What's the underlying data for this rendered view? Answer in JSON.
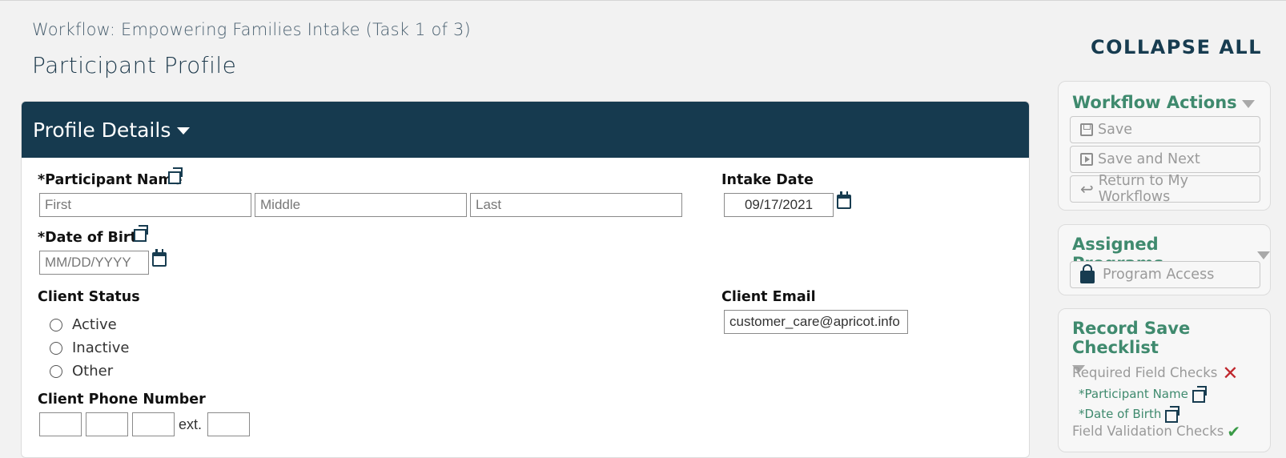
{
  "header": {
    "workflow_title": "Workflow: Empowering Families Intake (Task 1 of 3)",
    "page_title": "Participant Profile",
    "collapse_all": "COLLAPSE ALL"
  },
  "profile": {
    "section_title": "Profile Details",
    "participant_name": {
      "label": "*Participant Name",
      "first_placeholder": "First",
      "middle_placeholder": "Middle",
      "last_placeholder": "Last"
    },
    "intake_date": {
      "label": "Intake Date",
      "value": "09/17/2021"
    },
    "date_of_birth": {
      "label": "*Date of Birth",
      "placeholder": "MM/DD/YYYY"
    },
    "client_status": {
      "label": "Client Status",
      "options": [
        "Active",
        "Inactive",
        "Other"
      ]
    },
    "client_email": {
      "label": "Client Email",
      "value": "customer_care@apricot.info"
    },
    "client_phone": {
      "label": "Client Phone Number",
      "ext_label": "ext."
    }
  },
  "sidebar": {
    "workflow_actions": {
      "title": "Workflow Actions",
      "save": "Save",
      "save_next": "Save and Next",
      "return": "Return to My Workflows"
    },
    "assigned_programs": {
      "title": "Assigned Programs",
      "program_access": "Program Access"
    },
    "checklist": {
      "title": "Record Save Checklist",
      "required_checks": "Required Field Checks",
      "items": [
        "*Participant Name",
        "*Date of Birth"
      ],
      "validation_checks": "Field Validation Checks"
    }
  },
  "colors": {
    "header_bg": "#163a4f",
    "accent_green": "#3f8a6e",
    "error_red": "#c0272d",
    "ok_green": "#3a9a47"
  },
  "icons": [
    "copy-icon",
    "calendar-icon",
    "caret-down-icon",
    "save-icon",
    "play-icon",
    "back-arrow-icon",
    "lock-icon",
    "x-icon",
    "check-icon"
  ]
}
